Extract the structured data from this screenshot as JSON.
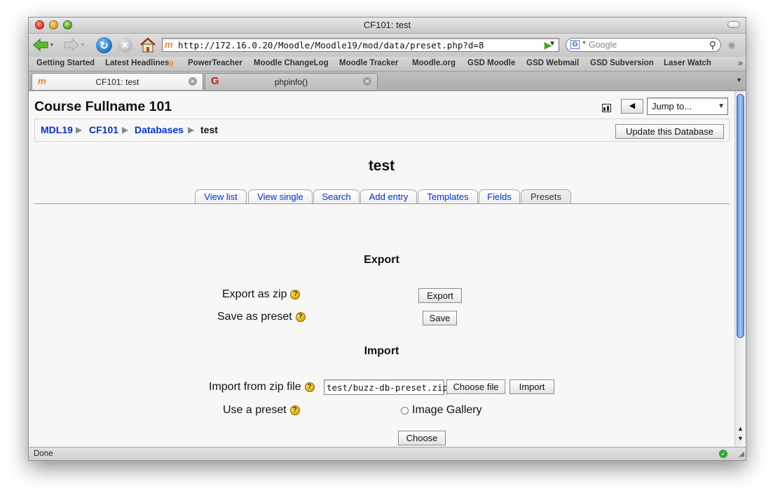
{
  "window": {
    "title": "CF101: test"
  },
  "toolbar": {
    "url": "http://172.16.0.20/Moodle/Moodle19/mod/data/preset.php?d=8",
    "search_placeholder": "Google"
  },
  "bookmarks": [
    "Getting Started",
    "Latest Headlines",
    "PowerTeacher",
    "Moodle ChangeLog",
    "Moodle Tracker",
    "Moodle.org",
    "GSD Moodle",
    "GSD Webmail",
    "GSD Subversion",
    "Laser Watch"
  ],
  "browser_tabs": [
    {
      "label": "CF101: test"
    },
    {
      "label": "phpinfo()"
    }
  ],
  "page": {
    "course_title": "Course Fullname 101",
    "jump_to": "Jump to...",
    "breadcrumbs": [
      "MDL19",
      "CF101",
      "Databases",
      "test"
    ],
    "update_button": "Update this Database",
    "heading": "test",
    "tabs": [
      "View list",
      "View single",
      "Search",
      "Add entry",
      "Templates",
      "Fields",
      "Presets"
    ],
    "export": {
      "heading": "Export",
      "zip_label": "Export as zip",
      "zip_button": "Export",
      "preset_label": "Save as preset",
      "preset_button": "Save"
    },
    "import": {
      "heading": "Import",
      "zip_label": "Import from zip file",
      "file_value": "test/buzz-db-preset.zip",
      "choose_file_button": "Choose file",
      "import_button": "Import",
      "preset_label": "Use a preset",
      "preset_option": "Image Gallery",
      "choose_button": "Choose"
    }
  },
  "status": {
    "text": "Done"
  },
  "icons": {
    "help": "?",
    "breadcrumb_separator": "▶"
  }
}
